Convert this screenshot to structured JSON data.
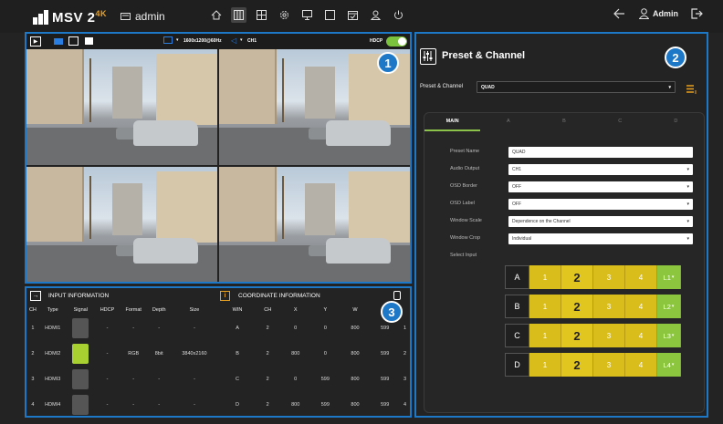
{
  "topbar": {
    "logo_text": "MSV 2",
    "logo_sup": "4K",
    "device_name": "admin",
    "user_label": "Admin",
    "nav_icons": [
      "home-icon",
      "matrix-icon",
      "layout-icon",
      "settings-icon",
      "display-icon",
      "window-icon",
      "calendar-icon",
      "users-icon",
      "power-icon"
    ]
  },
  "video": {
    "resolution": "1600x1200@60Hz",
    "audio": "CH1",
    "hdcp_label": "HDCP",
    "hdcp_on": true,
    "badge": "1"
  },
  "input_info": {
    "title": "INPUT INFORMATION",
    "columns": [
      "CH",
      "Type",
      "Signal",
      "HDCP",
      "Format",
      "Depth",
      "Size"
    ],
    "rows": [
      {
        "ch": "1",
        "type": "HDMI1",
        "signal": false,
        "hdcp": "-",
        "format": "-",
        "depth": "-",
        "size": "-"
      },
      {
        "ch": "2",
        "type": "HDMI2",
        "signal": true,
        "hdcp": "-",
        "format": "RGB",
        "depth": "8bit",
        "size": "3840x2160"
      },
      {
        "ch": "3",
        "type": "HDMI3",
        "signal": false,
        "hdcp": "-",
        "format": "-",
        "depth": "-",
        "size": "-"
      },
      {
        "ch": "4",
        "type": "HDMI4",
        "signal": false,
        "hdcp": "-",
        "format": "-",
        "depth": "-",
        "size": "-"
      }
    ]
  },
  "coord_info": {
    "title": "COORDINATE INFORMATION",
    "columns": [
      "WIN",
      "CH",
      "X",
      "Y",
      "W",
      "H",
      ""
    ],
    "rows": [
      {
        "win": "A",
        "ch": "2",
        "x": "0",
        "y": "0",
        "w": "800",
        "h": "599",
        "n": "1"
      },
      {
        "win": "B",
        "ch": "2",
        "x": "800",
        "y": "0",
        "w": "800",
        "h": "599",
        "n": "2"
      },
      {
        "win": "C",
        "ch": "2",
        "x": "0",
        "y": "599",
        "w": "800",
        "h": "599",
        "n": "3"
      },
      {
        "win": "D",
        "ch": "2",
        "x": "800",
        "y": "599",
        "w": "800",
        "h": "599",
        "n": "4"
      }
    ],
    "badge": "3"
  },
  "preset": {
    "title": "Preset & Channel",
    "badge": "2",
    "selector_label": "Preset & Channel",
    "selector_value": "QUAD",
    "tabs": [
      "MAIN",
      "A",
      "B",
      "C",
      "D"
    ],
    "fields": [
      {
        "label": "Preset Name",
        "value": "QUAD",
        "dropdown": false
      },
      {
        "label": "Audio Output",
        "value": "CH1",
        "dropdown": true
      },
      {
        "label": "OSD Border",
        "value": "OFF",
        "dropdown": true
      },
      {
        "label": "OSD Label",
        "value": "OFF",
        "dropdown": true
      },
      {
        "label": "Window Scale",
        "value": "Dependence on the Channel",
        "dropdown": true
      },
      {
        "label": "Window Crop",
        "value": "Individual",
        "dropdown": true
      }
    ],
    "select_input_label": "Select Input",
    "select_rows": [
      {
        "letter": "A",
        "inputs": [
          "1",
          "2",
          "3",
          "4"
        ],
        "selected": "2",
        "layer": "L1"
      },
      {
        "letter": "B",
        "inputs": [
          "1",
          "2",
          "3",
          "4"
        ],
        "selected": "2",
        "layer": "L2"
      },
      {
        "letter": "C",
        "inputs": [
          "1",
          "2",
          "3",
          "4"
        ],
        "selected": "2",
        "layer": "L3"
      },
      {
        "letter": "D",
        "inputs": [
          "1",
          "2",
          "3",
          "4"
        ],
        "selected": "2",
        "layer": "L4"
      }
    ]
  }
}
